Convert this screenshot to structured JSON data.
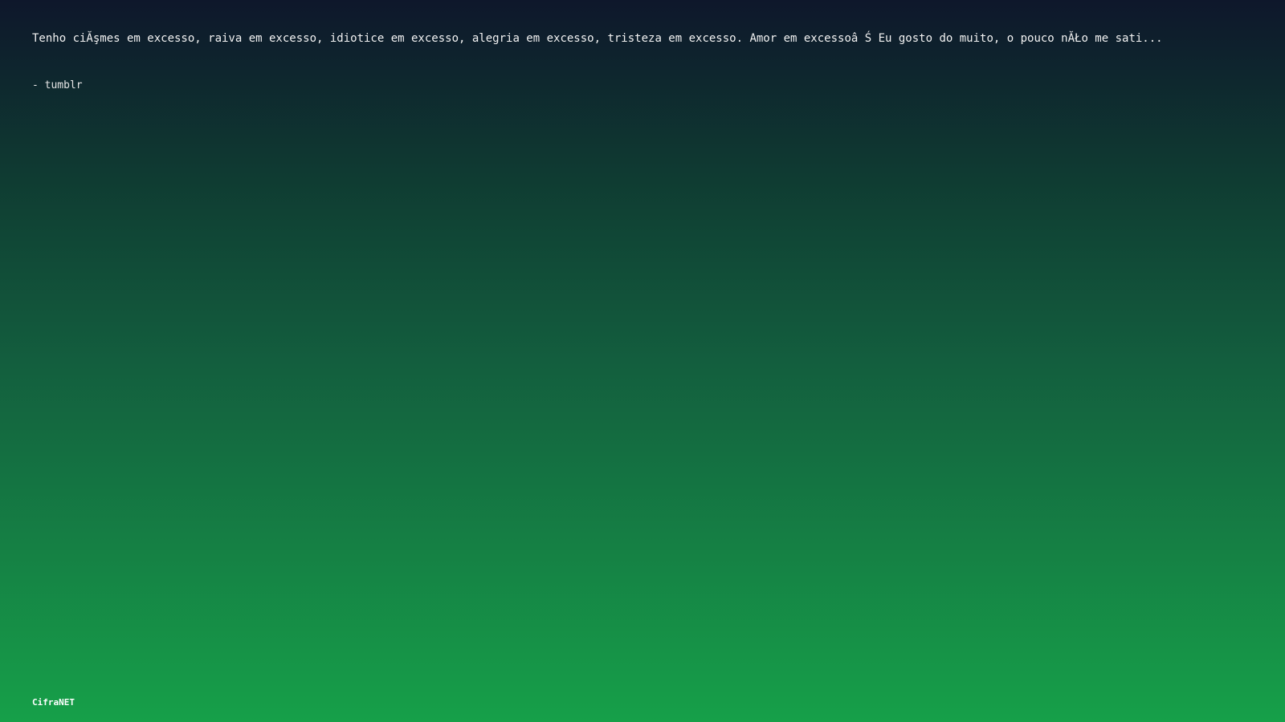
{
  "quote": {
    "text": "Tenho ciĂşmes em excesso, raiva em excesso, idiotice em excesso, alegria em excesso, tristeza em excesso. Amor em excessoâ Ś Eu gosto do muito, o pouco nĂŁo me sati..."
  },
  "author": {
    "text": "- tumblr"
  },
  "brand": {
    "name": "CifraNET"
  },
  "colors": {
    "gradient_top": "#0e172b",
    "gradient_bottom": "#16a049",
    "text": "#f2f2f2"
  }
}
